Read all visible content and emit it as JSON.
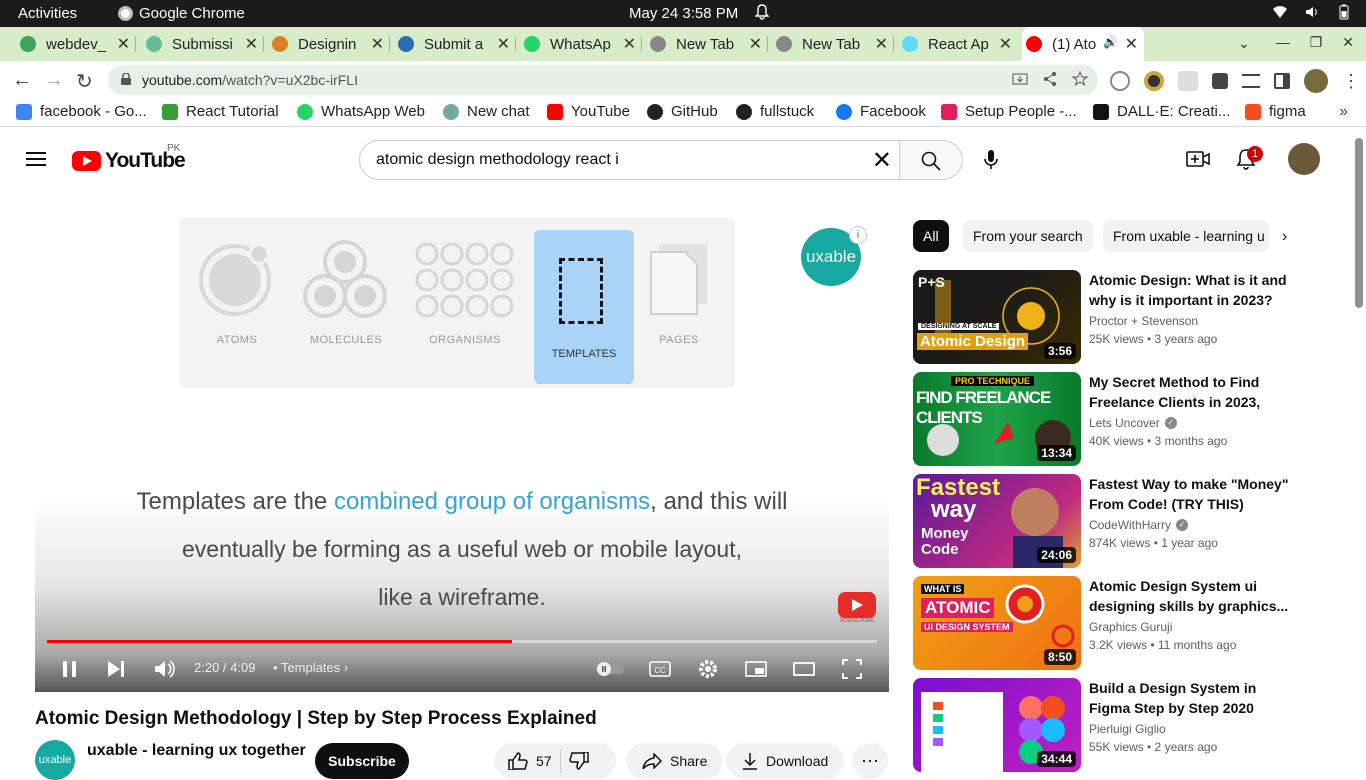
{
  "system": {
    "activities": "Activities",
    "app_name": "Google Chrome",
    "clock": "May 24  3:58 PM"
  },
  "tabs": [
    {
      "label": "webdev_",
      "color": "#3aa55a"
    },
    {
      "label": "Submissi",
      "color": "#6b9"
    },
    {
      "label": "Designin",
      "color": "#d9822b"
    },
    {
      "label": "Submit a",
      "color": "#2b6cb0"
    },
    {
      "label": "WhatsAp",
      "color": "#25d366"
    },
    {
      "label": "New Tab",
      "color": "#888"
    },
    {
      "label": "New Tab",
      "color": "#888"
    },
    {
      "label": "React Ap",
      "color": "#61dafb"
    },
    {
      "label": "(1) Ato",
      "color": "#ff0000",
      "active": true
    }
  ],
  "omnibox": {
    "host": "youtube.com",
    "path": "/watch?v=uX2bc-irFLI"
  },
  "bookmarks": [
    {
      "label": "facebook - Go...",
      "color": "#4285f4"
    },
    {
      "label": "React Tutorial",
      "color": "#3a9d3a"
    },
    {
      "label": "WhatsApp Web",
      "color": "#25d366"
    },
    {
      "label": "New chat",
      "color": "#74aa9c"
    },
    {
      "label": "YouTube",
      "color": "#ff0000"
    },
    {
      "label": "GitHub",
      "color": "#222"
    },
    {
      "label": "fullstuck",
      "color": "#222"
    },
    {
      "label": "Facebook",
      "color": "#1877f2"
    },
    {
      "label": "Setup People -...",
      "color": "#e01e5a"
    },
    {
      "label": "DALL·E: Creati...",
      "color": "#111"
    },
    {
      "label": "figma",
      "color": "#f24e1e"
    }
  ],
  "youtube": {
    "logo_text": "YouTube",
    "country": "PK",
    "search_query": "atomic design methodology react i",
    "notification_count": "1"
  },
  "player": {
    "slide_items": [
      "ATOMS",
      "MOLECULES",
      "ORGANISMS",
      "TEMPLATES",
      "PAGES"
    ],
    "channel_logo": "uxable",
    "caption_line1_a": "Templates are the ",
    "caption_line1_hl": "combined group of organisms",
    "caption_line1_b": ", and this will",
    "caption_line2": "eventually be forming as a useful web or mobile layout,",
    "caption_line3": "like a wireframe.",
    "subscribe_watermark": "SUBSCRIBE",
    "progress_fraction": 0.56,
    "time": "2:20 / 4:09",
    "chapter": "Templates"
  },
  "video": {
    "title": "Atomic Design Methodology | Step by Step Process Explained",
    "channel": "uxable - learning ux together",
    "channel_avatar": "uxable",
    "subscribe": "Subscribe",
    "likes": "57",
    "share": "Share",
    "download": "Download"
  },
  "chips": [
    "All",
    "From your search",
    "From uxable - learning u"
  ],
  "recommendations": [
    {
      "title": "Atomic Design: What is it and why is it important in 2023?",
      "channel": "Proctor + Stevenson",
      "verified": false,
      "meta": "25K views • 3 years ago",
      "duration": "3:56",
      "thumb_top": "P+S",
      "thumb_sub": "DESIGNING AT SCALE",
      "thumb_main": "Atomic Design"
    },
    {
      "title": "My Secret Method to Find Freelance Clients in 2023, Lets...",
      "channel": "Lets Uncover",
      "verified": true,
      "meta": "40K views • 3 months ago",
      "duration": "13:34",
      "thumb_top": "PRO TECHNIQUE",
      "thumb_main": "FIND FREELANCE CLIENTS"
    },
    {
      "title": "Fastest Way to make \"Money\" From Code! (TRY THIS)",
      "channel": "CodeWithHarry",
      "verified": true,
      "meta": "874K views • 1 year ago",
      "duration": "24:06",
      "thumb_top": "Fastest",
      "thumb_sub": "way",
      "thumb_main": "Money Code"
    },
    {
      "title": "Atomic Design System ui designing skills by graphics...",
      "channel": "Graphics Guruji",
      "verified": false,
      "meta": "3.2K views • 11 months ago",
      "duration": "8:50",
      "thumb_top": "WHAT IS",
      "thumb_sub": "ATOMIC",
      "thumb_main": "UI DESIGN SYSTEM"
    },
    {
      "title": "Build a Design System in Figma Step by Step 2020",
      "channel": "Pierluigi Giglio",
      "verified": false,
      "meta": "55K views • 2 years ago",
      "duration": "34:44"
    }
  ]
}
